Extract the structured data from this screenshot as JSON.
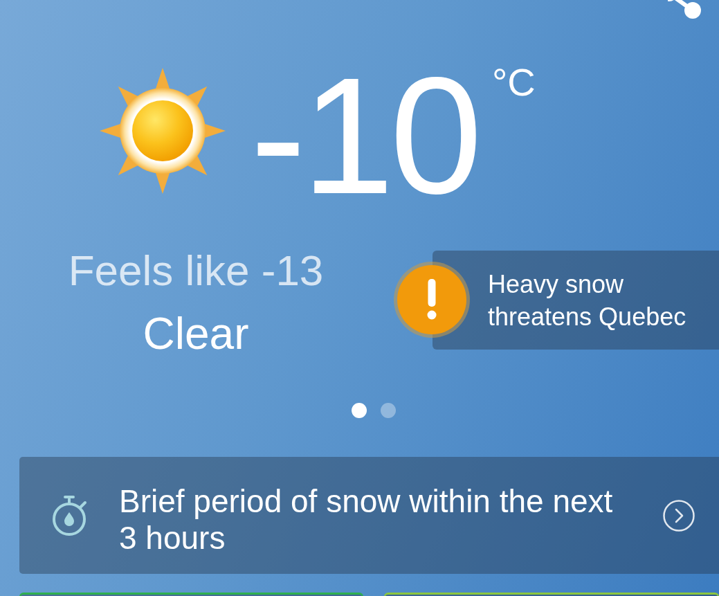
{
  "current": {
    "temperature": "-10",
    "unit": "°C",
    "feels_like": "Feels like -13",
    "condition": "Clear"
  },
  "alert": {
    "text": "Heavy snow threatens Quebec"
  },
  "pager": [
    {
      "selected": true
    },
    {
      "selected": false
    }
  ],
  "nowcast": {
    "text": "Brief period of snow within the next 3 hours"
  },
  "cards": [
    {
      "color": "#2fb04f"
    },
    {
      "color": "#8cc63f"
    }
  ]
}
